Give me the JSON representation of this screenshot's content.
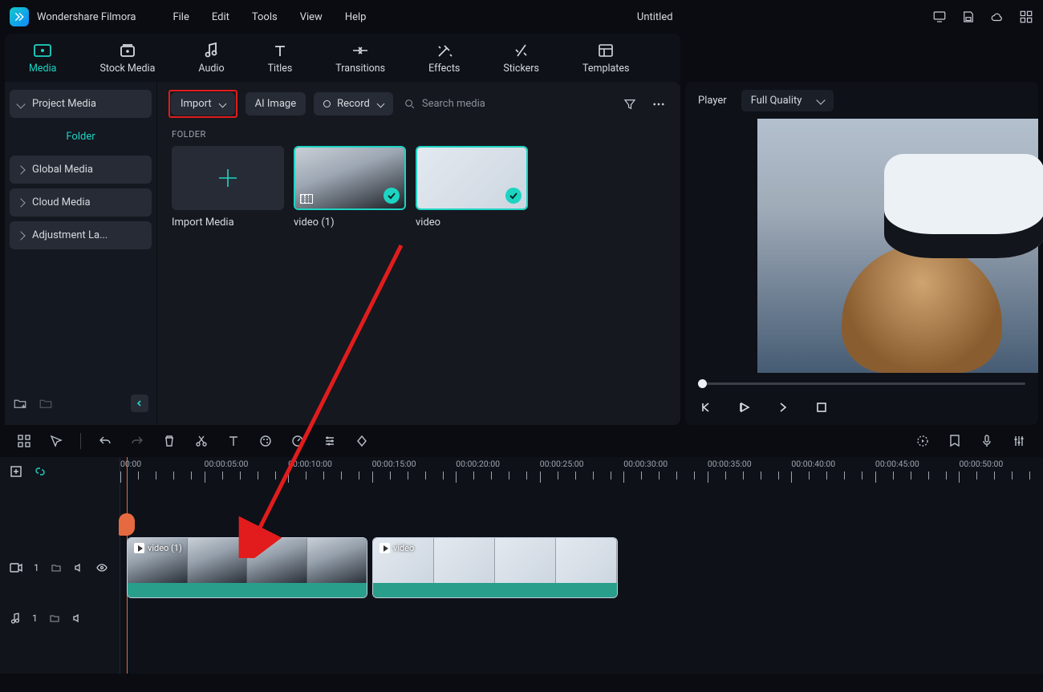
{
  "app": {
    "name": "Wondershare Filmora",
    "documentTitle": "Untitled"
  },
  "menubar": {
    "file": "File",
    "edit": "Edit",
    "tools": "Tools",
    "view": "View",
    "help": "Help"
  },
  "ribbon": {
    "media": "Media",
    "stockMedia": "Stock Media",
    "audio": "Audio",
    "titles": "Titles",
    "transitions": "Transitions",
    "effects": "Effects",
    "stickers": "Stickers",
    "templates": "Templates"
  },
  "leftPanel": {
    "projectMedia": "Project Media",
    "folderLabel": "Folder",
    "globalMedia": "Global Media",
    "cloudMedia": "Cloud Media",
    "adjustmentLayer": "Adjustment La..."
  },
  "toolbar": {
    "importLabel": "Import",
    "aiImageLabel": "AI Image",
    "recordLabel": "Record",
    "searchPlaceholder": "Search media"
  },
  "mediaSection": {
    "folderHeader": "FOLDER"
  },
  "mediaItems": {
    "importCard": "Import Media",
    "item1": "video (1)",
    "item2": "video"
  },
  "preview": {
    "playerLabel": "Player",
    "qualityLabel": "Full Quality"
  },
  "timeline": {
    "timecodes": {
      "t0": "00:00",
      "t1": "00:00:05:00",
      "t2": "00:00:10:00",
      "t3": "00:00:15:00",
      "t4": "00:00:20:00",
      "t5": "00:00:25:00",
      "t6": "00:00:30:00",
      "t7": "00:00:35:00",
      "t8": "00:00:40:00",
      "t9": "00:00:45:00",
      "t10": "00:00:50:00"
    },
    "videoTrack": "1",
    "audioTrack": "1",
    "clip1Label": "video (1)",
    "clip2Label": "video"
  }
}
